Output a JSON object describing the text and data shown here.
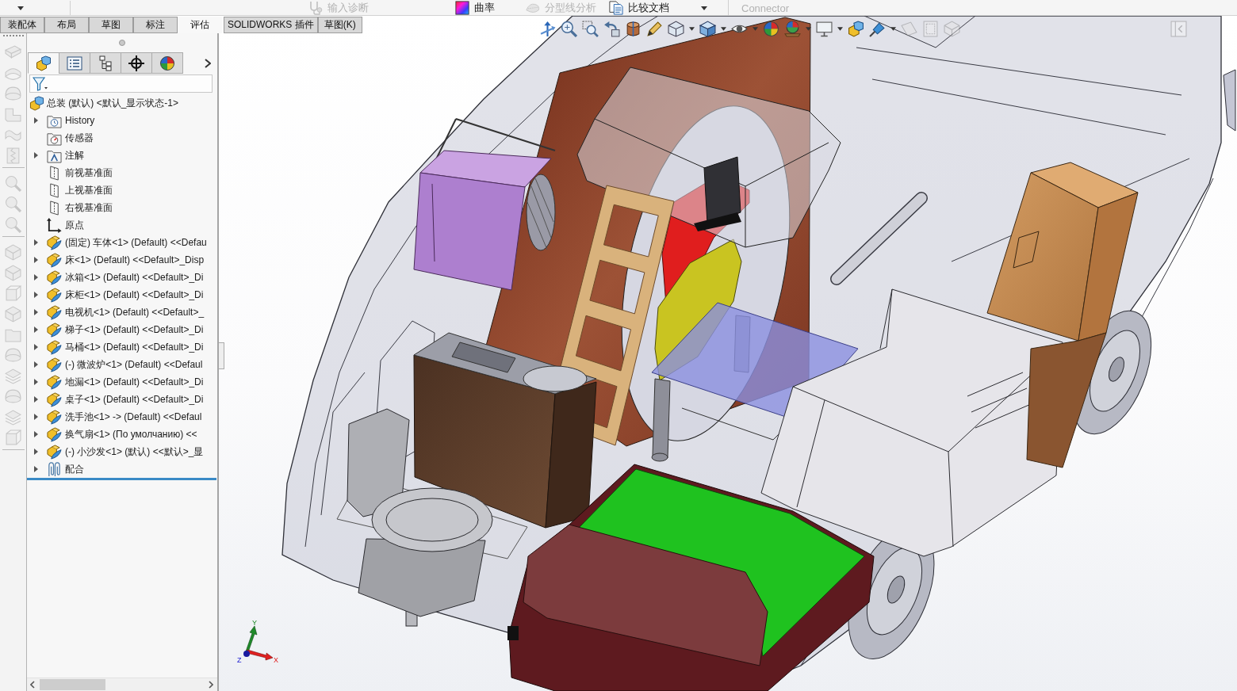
{
  "ribbon": {
    "items": [
      {
        "kind": "diagnose",
        "label": "输入诊断",
        "disabled": true
      },
      {
        "kind": "curvature",
        "label": "曲率",
        "disabled": false
      },
      {
        "kind": "parting",
        "label": "分型线分析",
        "disabled": true
      },
      {
        "kind": "compare",
        "label": "比较文档",
        "disabled": false
      }
    ],
    "connector": {
      "label": "Connector",
      "disabled": true
    }
  },
  "command_tabs": [
    {
      "label": "装配体",
      "selected": false
    },
    {
      "label": "布局",
      "selected": false
    },
    {
      "label": "草图",
      "selected": false
    },
    {
      "label": "标注",
      "selected": false
    },
    {
      "label": "评估",
      "selected": true
    },
    {
      "label": "SOLIDWORKS 插件",
      "selected": false
    },
    {
      "label": "草图(K)",
      "selected": false
    }
  ],
  "side_toolbar": [
    [
      {
        "kind": "plate",
        "disabled": true
      },
      {
        "kind": "shell",
        "disabled": true
      },
      {
        "kind": "dome",
        "disabled": true
      },
      {
        "kind": "bend",
        "disabled": true
      },
      {
        "kind": "wave",
        "disabled": true
      },
      {
        "kind": "zipper",
        "disabled": true
      }
    ],
    [
      {
        "kind": "magnifier",
        "disabled": true
      },
      {
        "kind": "magnifier",
        "disabled": true
      },
      {
        "kind": "magnifier",
        "disabled": true
      }
    ],
    [
      {
        "kind": "box",
        "disabled": true
      },
      {
        "kind": "box",
        "disabled": true
      },
      {
        "kind": "cube",
        "disabled": true
      },
      {
        "kind": "box",
        "disabled": true
      },
      {
        "kind": "folder",
        "disabled": true
      },
      {
        "kind": "dome",
        "disabled": true
      },
      {
        "kind": "stack",
        "disabled": true
      },
      {
        "kind": "dome",
        "disabled": true
      },
      {
        "kind": "stack",
        "disabled": true
      },
      {
        "kind": "cube",
        "disabled": true
      }
    ]
  ],
  "panel_tabs": [
    {
      "kind": "feature-tree",
      "selected": true
    },
    {
      "kind": "property",
      "selected": false
    },
    {
      "kind": "configuration",
      "selected": false
    },
    {
      "kind": "dimxpert",
      "selected": false
    },
    {
      "kind": "display",
      "selected": false
    }
  ],
  "tree": {
    "root": {
      "kind": "assembly",
      "label": "总装 (默认) <默认_显示状态-1>"
    },
    "children": [
      {
        "kind": "history",
        "label": "History",
        "expanded": false
      },
      {
        "kind": "sensors",
        "label": "传感器"
      },
      {
        "kind": "annotations",
        "label": "注解",
        "expanded": false
      },
      {
        "kind": "plane",
        "label": "前视基准面"
      },
      {
        "kind": "plane",
        "label": "上视基准面"
      },
      {
        "kind": "plane",
        "label": "右视基准面"
      },
      {
        "kind": "origin",
        "label": "原点"
      },
      {
        "kind": "component",
        "label": "(固定) 车体<1> (Default) <<Defau",
        "expanded": false
      },
      {
        "kind": "component",
        "label": "床<1> (Default) <<Default>_Disp",
        "expanded": false
      },
      {
        "kind": "component",
        "label": "冰箱<1> (Default) <<Default>_Di",
        "expanded": false
      },
      {
        "kind": "component",
        "label": "床柜<1> (Default) <<Default>_Di",
        "expanded": false
      },
      {
        "kind": "component",
        "label": "电视机<1> (Default) <<Default>_",
        "expanded": false
      },
      {
        "kind": "component",
        "label": "梯子<1> (Default) <<Default>_Di",
        "expanded": false
      },
      {
        "kind": "component",
        "label": "马桶<1> (Default) <<Default>_Di",
        "expanded": false
      },
      {
        "kind": "component",
        "label": "(-) 微波炉<1> (Default) <<Defaul",
        "expanded": false
      },
      {
        "kind": "component",
        "label": "地漏<1> (Default) <<Default>_Di",
        "expanded": false
      },
      {
        "kind": "component",
        "label": "桌子<1> (Default) <<Default>_Di",
        "expanded": false
      },
      {
        "kind": "component",
        "label": "洗手池<1> -> (Default) <<Defaul",
        "expanded": false
      },
      {
        "kind": "component",
        "label": "换气扇<1> (По умолчанию) <<",
        "expanded": false
      },
      {
        "kind": "component",
        "label": "(-) 小沙发<1> (默认) <<默认>_显",
        "expanded": false
      },
      {
        "kind": "mates",
        "label": "配合",
        "expanded": false
      }
    ]
  },
  "view_toolbar": [
    {
      "kind": "axis-arrows",
      "disabled": false
    },
    {
      "kind": "zoom",
      "disabled": false
    },
    {
      "kind": "zoom-area",
      "disabled": false
    },
    {
      "kind": "previous-view",
      "disabled": false
    },
    {
      "kind": "section",
      "disabled": false
    },
    {
      "kind": "annotation",
      "disabled": false
    },
    {
      "kind": "orientation",
      "menu": true,
      "disabled": false
    },
    {
      "kind": "display-style",
      "menu": true,
      "disabled": false
    },
    {
      "kind": "hide-show",
      "menu": true,
      "disabled": false
    },
    {
      "kind": "appearance",
      "disabled": false
    },
    {
      "kind": "scene",
      "menu": true,
      "disabled": false
    },
    {
      "kind": "view-settings",
      "menu": true,
      "disabled": false
    },
    {
      "kind": "component",
      "disabled": false
    },
    {
      "kind": "pin",
      "menu": true,
      "disabled": false
    },
    {
      "kind": "section-plane",
      "disabled": true
    },
    {
      "kind": "frame",
      "disabled": true
    },
    {
      "kind": "box",
      "disabled": true
    },
    {
      "kind": "panel",
      "disabled": true
    }
  ],
  "triad": {
    "x": "X",
    "y": "Y",
    "z": "Z"
  }
}
